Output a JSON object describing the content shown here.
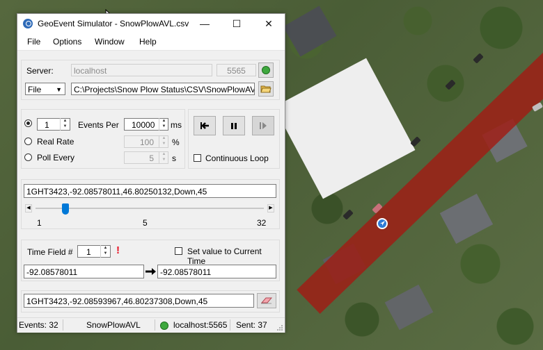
{
  "window": {
    "title": "GeoEvent Simulator - SnowPlowAVL.csv",
    "minimize": "—",
    "maximize": "☐",
    "close": "✕"
  },
  "menu": [
    "File",
    "Options",
    "Window",
    "Help"
  ],
  "server": {
    "label": "Server:",
    "host": "localhost",
    "port": "5565"
  },
  "source": {
    "type": "File",
    "path": "C:\\Projects\\Snow Plow Status\\CSV\\SnowPlowAVL.csv"
  },
  "rate": {
    "count": "1",
    "events_per_label": "Events Per",
    "events_per_value": "10000",
    "events_per_unit": "ms",
    "real_rate_label": "Real Rate",
    "real_rate_value": "100",
    "real_rate_unit": "%",
    "poll_every_label": "Poll Every",
    "poll_every_value": "5",
    "poll_every_unit": "s"
  },
  "playback": {
    "continuous_loop_label": "Continuous Loop"
  },
  "current_event": "1GHT3423,-92.08578011,46.80250132,Down,45",
  "slider": {
    "min": "1",
    "mid": "5",
    "max": "32",
    "position_fraction": 0.13
  },
  "time_field": {
    "label": "Time Field #",
    "value": "1",
    "set_current_label": "Set value to Current Time",
    "original": "-92.08578011",
    "replaced": "-92.08578011",
    "warning": "!"
  },
  "sent_event": "1GHT3423,-92.08593967,46.80237308,Down,45",
  "status": {
    "events": "Events: 32",
    "file": "SnowPlowAVL",
    "server": "localhost:5565",
    "sent": "Sent: 37"
  },
  "colors": {
    "route_overlay": "#a01c14",
    "slider_thumb": "#0078d7",
    "warning": "#e81123"
  }
}
